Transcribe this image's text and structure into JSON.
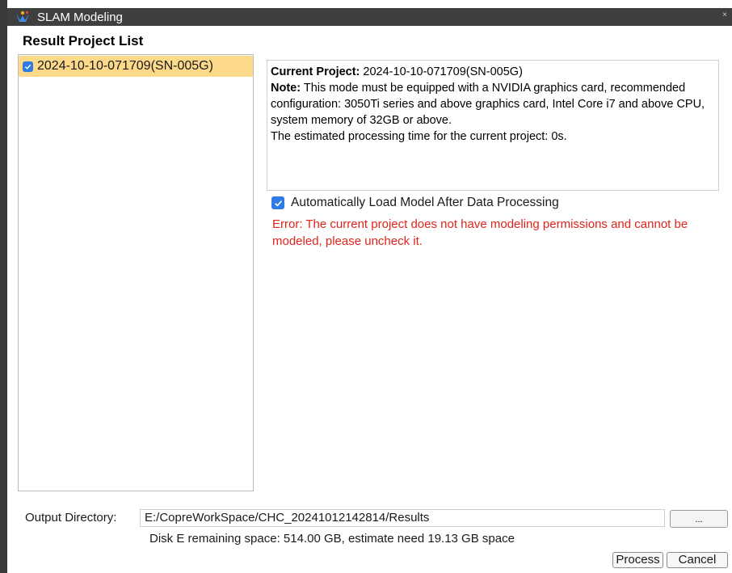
{
  "window": {
    "title": "SLAM Modeling",
    "close_glyph": "×",
    "app_icon": "slam-app-icon"
  },
  "project_list": {
    "heading": "Result Project List",
    "items": [
      {
        "label": "2024-10-10-071709(SN-005G)",
        "checked": true,
        "selected": true
      }
    ]
  },
  "info": {
    "current_project_label": "Current Project:",
    "current_project_value": "2024-10-10-071709(SN-005G)",
    "note_label": "Note:",
    "note_text": "This mode must be equipped with a NVIDIA graphics card, recommended configuration: 3050Ti series and above graphics card, Intel Core i7 and above CPU, system memory of 32GB or above.",
    "estimate_text": "The estimated processing time for the current project: 0s."
  },
  "auto_load": {
    "label": "Automatically Load Model After Data Processing",
    "checked": true
  },
  "error": {
    "text": "Error: The current project does not have modeling permissions and cannot be modeled, please uncheck it."
  },
  "output": {
    "label": "Output Directory:",
    "value": "E:/CopreWorkSpace/CHC_20241012142814/Results",
    "browse_label": "...",
    "disk_info": "Disk E remaining space: 514.00 GB, estimate need 19.13 GB space"
  },
  "actions": {
    "process_label": "Process",
    "cancel_label": "Cancel"
  },
  "colors": {
    "titlebar": "#3f3f3f",
    "selection": "#fdd98a",
    "checkbox": "#2f7ae5",
    "error": "#e0241b"
  }
}
